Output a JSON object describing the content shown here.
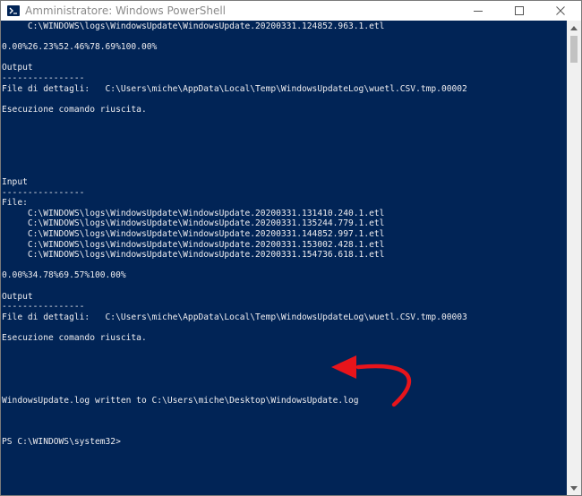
{
  "window": {
    "title": "Amministratore: Windows PowerShell",
    "icon": "powershell-icon",
    "controls": [
      "minimize-icon",
      "maximize-icon",
      "close-icon"
    ]
  },
  "console": {
    "lines": [
      "     C:\\WINDOWS\\logs\\WindowsUpdate\\WindowsUpdate.20200331.124852.963.1.etl",
      "",
      "0.00%26.23%52.46%78.69%100.00%",
      "",
      "Output",
      "----------------",
      "File di dettagli:   C:\\Users\\miche\\AppData\\Local\\Temp\\WindowsUpdateLog\\wuetl.CSV.tmp.00002",
      "",
      "Esecuzione comando riuscita.",
      "",
      "",
      "",
      "",
      "",
      "",
      "Input",
      "----------------",
      "File:",
      "     C:\\WINDOWS\\logs\\WindowsUpdate\\WindowsUpdate.20200331.131410.240.1.etl",
      "     C:\\WINDOWS\\logs\\WindowsUpdate\\WindowsUpdate.20200331.135244.779.1.etl",
      "     C:\\WINDOWS\\logs\\WindowsUpdate\\WindowsUpdate.20200331.144852.997.1.etl",
      "     C:\\WINDOWS\\logs\\WindowsUpdate\\WindowsUpdate.20200331.153002.428.1.etl",
      "     C:\\WINDOWS\\logs\\WindowsUpdate\\WindowsUpdate.20200331.154736.618.1.etl",
      "",
      "0.00%34.78%69.57%100.00%",
      "",
      "Output",
      "----------------",
      "File di dettagli:   C:\\Users\\miche\\AppData\\Local\\Temp\\WindowsUpdateLog\\wuetl.CSV.tmp.00003",
      "",
      "Esecuzione comando riuscita.",
      "",
      "",
      "",
      "",
      "",
      "WindowsUpdate.log written to C:\\Users\\miche\\Desktop\\WindowsUpdate.log",
      "",
      "",
      "",
      "PS C:\\WINDOWS\\system32>"
    ]
  },
  "annotation": {
    "icon": "red-curved-arrow-icon",
    "color": "#e8141b"
  },
  "colors": {
    "console_bg": "#012456",
    "console_text": "#eeedf0"
  }
}
